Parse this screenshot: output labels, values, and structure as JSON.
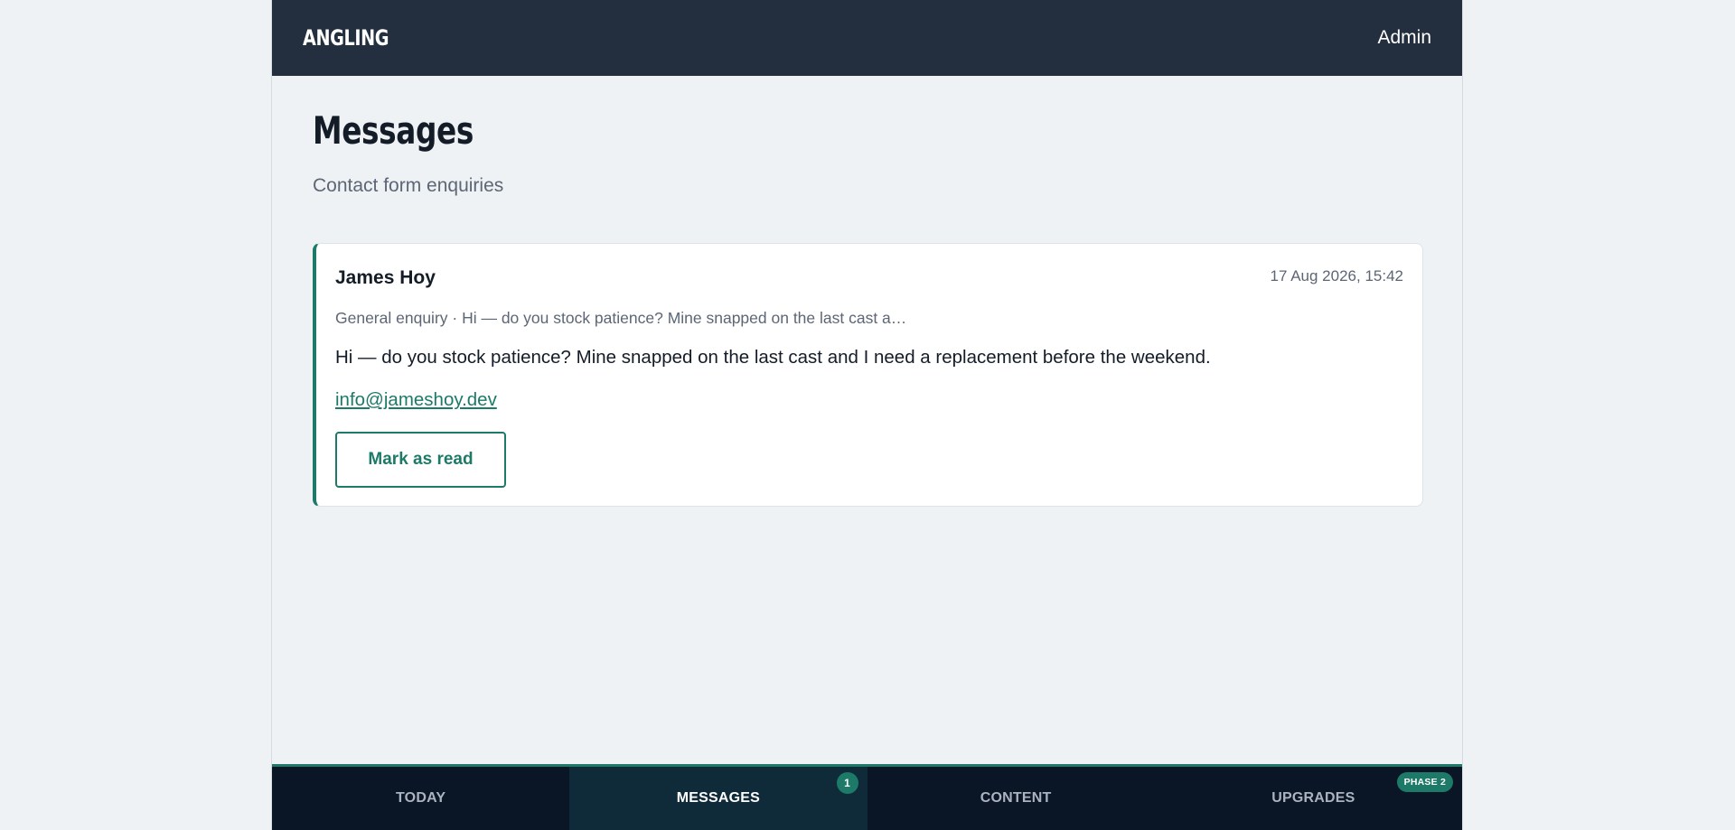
{
  "header": {
    "brand": "ANGLING",
    "user_label": "Admin"
  },
  "page": {
    "title": "Messages",
    "subtitle": "Contact form enquiries"
  },
  "messages": [
    {
      "sender": "James Hoy",
      "timestamp": "17 Aug 2026, 15:42",
      "preview": "General enquiry · Hi — do you stock patience? Mine snapped on the last cast a…",
      "body": "Hi — do you stock patience? Mine snapped on the last cast and I need a replacement before the weekend.",
      "email": "info@jameshoy.dev",
      "action_label": "Mark as read"
    }
  ],
  "bottom_nav": {
    "items": [
      {
        "label": "TODAY"
      },
      {
        "label": "MESSAGES",
        "badge": "1"
      },
      {
        "label": "CONTENT"
      },
      {
        "label": "UPGRADES",
        "badge": "PHASE 2"
      }
    ],
    "active_index": 1
  },
  "colors": {
    "accent": "#1d7a68",
    "header_bg": "#232f3f",
    "nav_bg": "#0a1526",
    "nav_active_bg": "#0f2b3a",
    "page_bg": "#eef2f5"
  }
}
